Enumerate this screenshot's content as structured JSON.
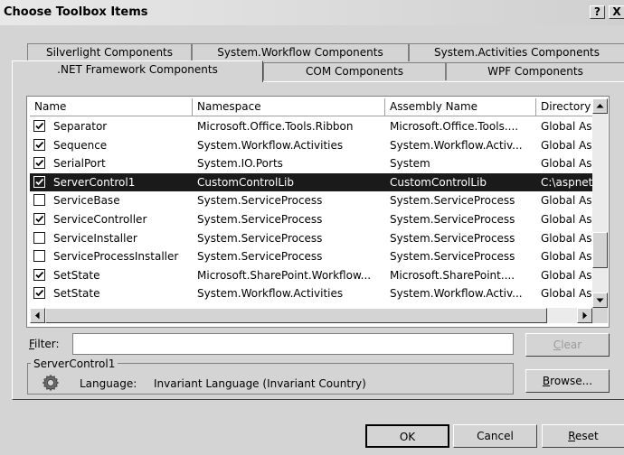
{
  "window": {
    "title": "Choose Toolbox Items",
    "help_label": "?",
    "close_label": "X"
  },
  "tabs_row1": [
    "Silverlight Components",
    "System.Workflow Components",
    "System.Activities Components"
  ],
  "tabs_row2": [
    ".NET Framework Components",
    "COM Components",
    "WPF Components"
  ],
  "active_tab": ".NET Framework Components",
  "columns": [
    "Name",
    "Namespace",
    "Assembly Name",
    "Directory"
  ],
  "rows": [
    {
      "checked": true,
      "name": "Separator",
      "namespace": "Microsoft.Office.Tools.Ribbon",
      "assembly": "Microsoft.Office.Tools....",
      "directory": "Global Ass"
    },
    {
      "checked": true,
      "name": "Sequence",
      "namespace": "System.Workflow.Activities",
      "assembly": "System.Workflow.Activ...",
      "directory": "Global Ass"
    },
    {
      "checked": true,
      "name": "SerialPort",
      "namespace": "System.IO.Ports",
      "assembly": "System",
      "directory": "Global Ass"
    },
    {
      "checked": true,
      "name": "ServerControl1",
      "namespace": "CustomControlLib",
      "assembly": "CustomControlLib",
      "directory": "C:\\aspnet",
      "selected": true
    },
    {
      "checked": false,
      "name": "ServiceBase",
      "namespace": "System.ServiceProcess",
      "assembly": "System.ServiceProcess",
      "directory": "Global Ass"
    },
    {
      "checked": true,
      "name": "ServiceController",
      "namespace": "System.ServiceProcess",
      "assembly": "System.ServiceProcess",
      "directory": "Global Ass"
    },
    {
      "checked": false,
      "name": "ServiceInstaller",
      "namespace": "System.ServiceProcess",
      "assembly": "System.ServiceProcess",
      "directory": "Global Ass"
    },
    {
      "checked": false,
      "name": "ServiceProcessInstaller",
      "namespace": "System.ServiceProcess",
      "assembly": "System.ServiceProcess",
      "directory": "Global Ass"
    },
    {
      "checked": true,
      "name": "SetState",
      "namespace": "Microsoft.SharePoint.Workflow...",
      "assembly": "Microsoft.SharePoint....",
      "directory": "Global Ass"
    },
    {
      "checked": true,
      "name": "SetState",
      "namespace": "System.Workflow.Activities",
      "assembly": "System.Workflow.Activ...",
      "directory": "Global Ass"
    }
  ],
  "filter": {
    "label_prefix": "F",
    "label_rest": "ilter:",
    "value": ""
  },
  "clear": {
    "u": "C",
    "rest": "lear"
  },
  "browse": {
    "u": "B",
    "rest": "rowse..."
  },
  "details": {
    "group_title": "ServerControl1",
    "language_label": "Language:",
    "language_value": "Invariant Language (Invariant Country)"
  },
  "buttons": {
    "ok": "OK",
    "cancel": "Cancel",
    "reset_u": "R",
    "reset_rest": "eset"
  }
}
